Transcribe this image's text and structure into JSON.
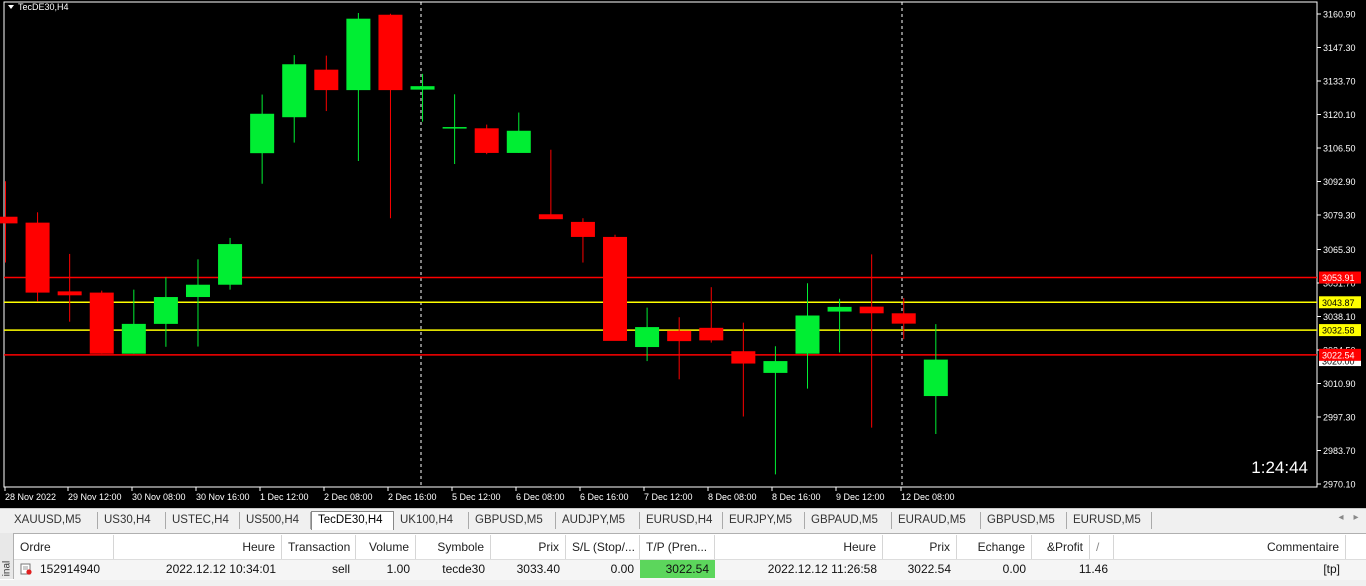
{
  "chart": {
    "title": "TecDE30,H4",
    "countdown": "1:24:44",
    "bull_color": "#00ee33",
    "bear_color": "#ff0000",
    "price_axis": [
      "3160.90",
      "3147.30",
      "3133.70",
      "3120.10",
      "3106.50",
      "3092.90",
      "3079.30",
      "3065.30",
      "3051.70",
      "3038.10",
      "3024.50",
      "3010.90",
      "2997.30",
      "2983.70",
      "2970.10"
    ],
    "time_axis": [
      "28 Nov 2022",
      "29 Nov 12:00",
      "30 Nov 08:00",
      "30 Nov 16:00",
      "1 Dec 12:00",
      "2 Dec 08:00",
      "2 Dec 16:00",
      "5 Dec 12:00",
      "6 Dec 08:00",
      "6 Dec 16:00",
      "7 Dec 12:00",
      "8 Dec 08:00",
      "8 Dec 16:00",
      "9 Dec 12:00",
      "12 Dec 08:00"
    ],
    "levels": [
      {
        "price": 3053.91,
        "label": "3053.91",
        "color": "#ff0000"
      },
      {
        "price": 3043.87,
        "label": "3043.87",
        "color": "#ffff00"
      },
      {
        "price": 3032.58,
        "label": "3032.58",
        "color": "#ffff00"
      },
      {
        "price": 3022.54,
        "label": "3022.54",
        "color": "#ff0000"
      }
    ],
    "current_price_label": "3020.00"
  },
  "chart_data": {
    "type": "candlestick",
    "ylim": [
      2970.1,
      3163.0
    ],
    "x": [
      "28 Nov 2022",
      "",
      "29 Nov 12:00",
      "",
      "",
      "30 Nov 08:00",
      "",
      "30 Nov 16:00",
      "",
      "1 Dec 12:00",
      "",
      "2 Dec 08:00",
      "",
      "2 Dec 16:00",
      "",
      "5 Dec 12:00",
      "",
      "6 Dec 08:00",
      "",
      "6 Dec 16:00",
      "",
      "7 Dec 12:00",
      "",
      "8 Dec 08:00",
      "",
      "8 Dec 16:00",
      "",
      "9 Dec 12:00",
      "",
      "12 Dec 08:00"
    ],
    "open": [
      3078.6,
      3076.2,
      3048.3,
      3047.8,
      3023.0,
      3035.1,
      3046.0,
      3051.0,
      3104.4,
      3119.0,
      3138.3,
      3130.0,
      3160.6,
      3130.2,
      3115.0,
      3114.5,
      3104.5,
      3079.6,
      3076.5,
      3070.4,
      3025.7,
      3032.3,
      3033.5,
      3024.0,
      3015.2,
      3023.0,
      3040.1,
      3042.1,
      3039.4,
      3005.8
    ],
    "high": [
      3093.0,
      3080.4,
      3063.5,
      3048.6,
      3049.0,
      3054.0,
      3061.3,
      3070.0,
      3128.2,
      3144.2,
      3144.0,
      3161.3,
      3161.0,
      3136.6,
      3128.3,
      3116.0,
      3120.9,
      3105.8,
      3078.0,
      3071.3,
      3041.7,
      3037.8,
      3050.0,
      3035.6,
      3026.0,
      3051.6,
      3045.3,
      3063.3,
      3045.6,
      3035.0
    ],
    "low": [
      3060.0,
      3044.3,
      3036.0,
      3023.0,
      3023.0,
      3025.8,
      3025.9,
      3049.0,
      3092.0,
      3108.7,
      3121.5,
      3101.2,
      3078.0,
      3117.2,
      3100.0,
      3104.0,
      3104.5,
      3078.6,
      3060.0,
      3070.4,
      3020.0,
      3012.6,
      3027.5,
      2997.5,
      2974.0,
      3008.8,
      3023.5,
      2993.0,
      3028.9,
      2990.4
    ],
    "close": [
      3075.9,
      3047.8,
      3046.7,
      3023.0,
      3035.1,
      3046.0,
      3051.0,
      3067.5,
      3120.4,
      3140.5,
      3130.0,
      3159.0,
      3130.0,
      3131.6,
      3115.0,
      3104.5,
      3113.5,
      3077.6,
      3070.4,
      3028.2,
      3033.8,
      3028.1,
      3028.4,
      3019.0,
      3020.0,
      3038.5,
      3042.0,
      3039.4,
      3035.2,
      3020.6
    ]
  },
  "tabs": [
    {
      "label": "XAUUSD,M5",
      "active": false
    },
    {
      "label": "US30,H4",
      "active": false
    },
    {
      "label": "USTEC,H4",
      "active": false
    },
    {
      "label": "US500,H4",
      "active": false
    },
    {
      "label": "TecDE30,H4",
      "active": true
    },
    {
      "label": "UK100,H4",
      "active": false
    },
    {
      "label": "GBPUSD,M5",
      "active": false
    },
    {
      "label": "AUDJPY,M5",
      "active": false
    },
    {
      "label": "EURUSD,H4",
      "active": false
    },
    {
      "label": "EURJPY,M5",
      "active": false
    },
    {
      "label": "GBPAUD,M5",
      "active": false
    },
    {
      "label": "EURAUD,M5",
      "active": false
    },
    {
      "label": "GBPUSD,M5",
      "active": false
    },
    {
      "label": "EURUSD,M5",
      "active": false
    }
  ],
  "terminal": {
    "side_label": "inal",
    "columns": [
      "Ordre",
      "Heure",
      "Transaction",
      "Volume",
      "Symbole",
      "Prix",
      "S/L (Stop/...",
      "T/P (Pren...",
      "Heure",
      "Prix",
      "Echange",
      "&Profit",
      "Commentaire"
    ],
    "sort_marker": "/",
    "row": {
      "ordre": "152914940",
      "heure_open": "2022.12.12 10:34:01",
      "transaction": "sell",
      "volume": "1.00",
      "symbole": "tecde30",
      "prix_open": "3033.40",
      "sl": "0.00",
      "tp": "3022.54",
      "heure_close": "2022.12.12 11:26:58",
      "prix_close": "3022.54",
      "echange": "0.00",
      "profit": "11.46",
      "commentaire": "[tp]"
    }
  }
}
